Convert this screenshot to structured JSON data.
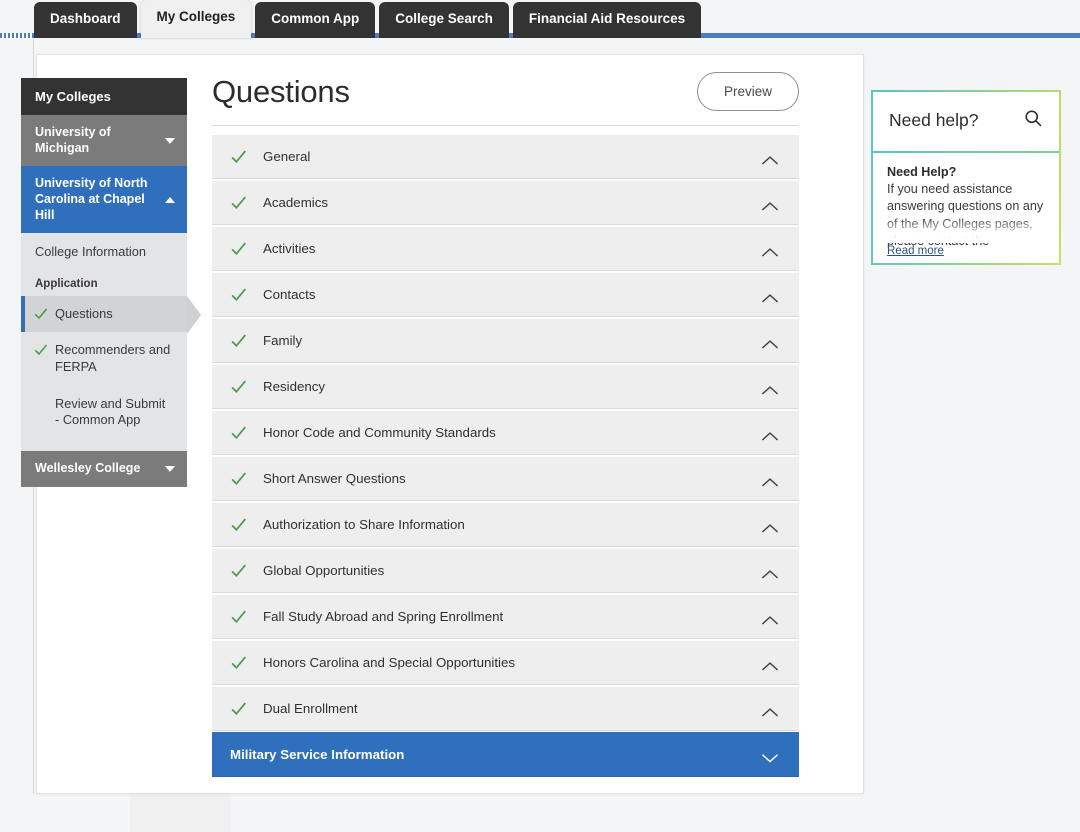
{
  "tabs": [
    {
      "label": "Dashboard",
      "active": false
    },
    {
      "label": "My Colleges",
      "active": true
    },
    {
      "label": "Common App",
      "active": false
    },
    {
      "label": "College Search",
      "active": false
    },
    {
      "label": "Financial Aid Resources",
      "active": false
    }
  ],
  "sidebar": {
    "header": "My Colleges",
    "colleges": [
      {
        "name": "University of Michigan",
        "expanded": false,
        "caret": "chevron-down-icon"
      },
      {
        "name": "University of North Carolina at Chapel Hill",
        "expanded": true,
        "caret": "chevron-up-icon"
      }
    ],
    "sub_link": "College Information",
    "group_label": "Application",
    "items": [
      {
        "label": "Questions",
        "complete": true,
        "current": true
      },
      {
        "label": "Recommenders and FERPA",
        "complete": true,
        "current": false
      },
      {
        "label": "Review and Submit - Common App",
        "complete": false,
        "current": false
      }
    ],
    "footer_college": {
      "name": "Wellesley College",
      "expanded": false,
      "caret": "chevron-down-icon"
    }
  },
  "main": {
    "title": "Questions",
    "preview_button": "Preview",
    "sections": [
      {
        "label": "General",
        "complete": true,
        "expanded": false,
        "selected": false
      },
      {
        "label": "Academics",
        "complete": true,
        "expanded": false,
        "selected": false
      },
      {
        "label": "Activities",
        "complete": true,
        "expanded": false,
        "selected": false
      },
      {
        "label": "Contacts",
        "complete": true,
        "expanded": false,
        "selected": false
      },
      {
        "label": "Family",
        "complete": true,
        "expanded": false,
        "selected": false
      },
      {
        "label": "Residency",
        "complete": true,
        "expanded": false,
        "selected": false
      },
      {
        "label": "Honor Code and Community Standards",
        "complete": true,
        "expanded": false,
        "selected": false
      },
      {
        "label": "Short Answer Questions",
        "complete": true,
        "expanded": false,
        "selected": false
      },
      {
        "label": "Authorization to Share Information",
        "complete": true,
        "expanded": false,
        "selected": false
      },
      {
        "label": "Global Opportunities",
        "complete": true,
        "expanded": false,
        "selected": false
      },
      {
        "label": "Fall Study Abroad and Spring Enrollment",
        "complete": true,
        "expanded": false,
        "selected": false
      },
      {
        "label": "Honors Carolina and Special Opportunities",
        "complete": true,
        "expanded": false,
        "selected": false
      },
      {
        "label": "Dual Enrollment",
        "complete": true,
        "expanded": false,
        "selected": false
      },
      {
        "label": "Military Service Information",
        "complete": false,
        "expanded": true,
        "selected": true
      }
    ]
  },
  "help": {
    "header_title": "Need help?",
    "search_icon": "search-icon",
    "body_title": "Need Help?",
    "body_text": "If you need assistance answering questions on any of the My Colleges pages, please contact the",
    "read_more": "Read more"
  },
  "colors": {
    "accent_blue": "#2f6fbb",
    "tab_dark": "#333333",
    "check_green": "#4a9a4a",
    "help_gradient_start": "#59c3c8",
    "help_gradient_end": "#cbdd66"
  }
}
